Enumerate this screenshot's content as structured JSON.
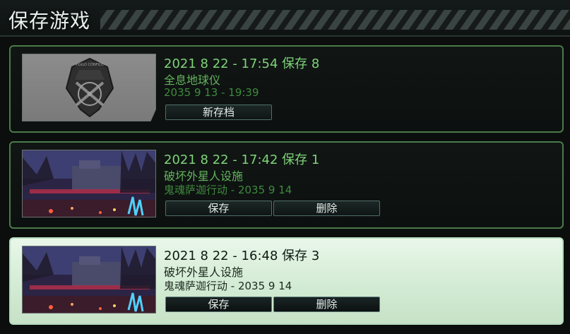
{
  "header": {
    "title": "保存游戏"
  },
  "slots": [
    {
      "line1": "2021 8 22 - 17:54 保存 8",
      "line2": "全息地球仪",
      "line3": "2035 9 13 - 19:39",
      "thumbnail": "xcom-emblem",
      "emblem_text": "VIGILO CONFIDO",
      "buttons": [
        {
          "label": "新存档"
        }
      ]
    },
    {
      "line1": "2021 8 22 - 17:42 保存 1",
      "line2": "破坏外星人设施",
      "line3": "鬼魂萨迦行动 - 2035 9 14",
      "thumbnail": "mission-scene",
      "buttons": [
        {
          "label": "保存"
        },
        {
          "label": "删除"
        }
      ]
    },
    {
      "line1": "2021 8 22 - 16:48 保存 3",
      "line2": "破坏外星人设施",
      "line3": "鬼魂萨迦行动 - 2035 9 14",
      "thumbnail": "mission-scene",
      "selected": true,
      "buttons": [
        {
          "label": "保存"
        },
        {
          "label": "删除"
        }
      ]
    }
  ],
  "colors": {
    "slot_border": "#4b7a4a",
    "text_primary_green": "#7fd37a",
    "selected_background": "#d3ebd4"
  }
}
